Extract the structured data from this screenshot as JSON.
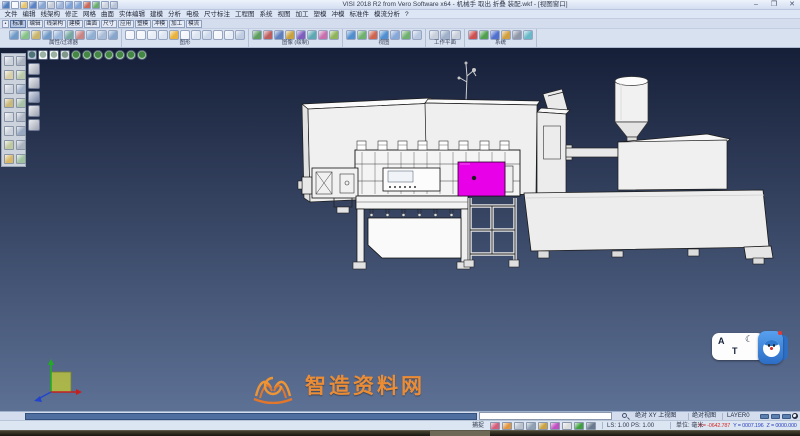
{
  "colors": {
    "vp_top": "#161f38",
    "vp_bottom": "#5d7195",
    "accent_magenta": "#e800e8",
    "watermark_orange": "#ec8d35",
    "statusbar_blue": "#4f6fa0",
    "coord_x_red": "#d42a2a",
    "coord_yz_blue": "#2a3fbf"
  },
  "window": {
    "title": "VISI 2018 R2 from Vero Software x64 - 机械手 取出 折叠 装配.wkf - [视图窗口]",
    "minimize": "–",
    "maximize": "❐",
    "close": "✕"
  },
  "quick_access": {
    "icons": [
      {
        "name": "app-icon",
        "color": "#4f7ec0"
      },
      {
        "name": "new-file-icon",
        "color": "#f4f7fb"
      },
      {
        "name": "open-file-icon",
        "color": "#e9c66a"
      },
      {
        "name": "save-icon",
        "color": "#5a82c4"
      },
      {
        "name": "save-all-icon",
        "color": "#86a6d6"
      },
      {
        "name": "print-icon",
        "color": "#c6cdd8"
      },
      {
        "name": "plot-icon",
        "color": "#9fb6da"
      },
      {
        "name": "undo-icon",
        "color": "#7fa3d8"
      },
      {
        "name": "redo-icon",
        "color": "#7fa3d8"
      },
      {
        "name": "delete-icon",
        "color": "#c96a5a"
      },
      {
        "name": "refresh-icon",
        "color": "#6aae6a"
      },
      {
        "name": "settings-icon",
        "color": "#ccd3de"
      },
      {
        "name": "help-icon",
        "color": "#b9c4d6"
      }
    ]
  },
  "menubar": {
    "items": [
      "文件",
      "编辑",
      "线架构",
      "修正",
      "网格",
      "曲面",
      "实体编辑",
      "建模",
      "分析",
      "电极",
      "尺寸标注",
      "工程图",
      "系统",
      "视图",
      "加工",
      "塑模",
      "冲模",
      "标准件",
      "模流分析",
      "?"
    ]
  },
  "tabbar": {
    "prefix": "•",
    "tabs": [
      "标准",
      "编辑",
      "线架构",
      "建模",
      "曲面",
      "尺寸",
      "应用",
      "塑模",
      "冲模",
      "加工",
      "模流"
    ]
  },
  "toolbar": {
    "groups": [
      {
        "label": "属性/过滤器",
        "icons": [
          {
            "name": "attr-color-icon",
            "color": "#6f9ac8"
          },
          {
            "name": "attr-layer-icon",
            "color": "#85c285"
          },
          {
            "name": "attr-linetype-icon",
            "color": "#c8b46a"
          },
          {
            "name": "filter-point-icon",
            "color": "#6f9ac8"
          },
          {
            "name": "filter-line-icon",
            "color": "#9ab6da"
          },
          {
            "name": "filter-surface-icon",
            "color": "#74a8a0"
          },
          {
            "name": "filter-solid-icon",
            "color": "#c88585"
          },
          {
            "name": "filter-all-icon",
            "color": "#8fb0d5"
          },
          {
            "name": "selection-mask-icon",
            "color": "#a8bcd8"
          },
          {
            "name": "quick-filter-icon",
            "color": "#87a6cc"
          }
        ]
      },
      {
        "label": "图形",
        "icons": [
          {
            "name": "new-drawing-icon",
            "color": "#f3f6fb"
          },
          {
            "name": "open-drawing-icon",
            "color": "#f3f6fb"
          },
          {
            "name": "insert-drawing-icon",
            "color": "#e7edf6"
          },
          {
            "name": "page-setup-icon",
            "color": "#dbe4f1"
          },
          {
            "name": "highlight-entities-icon",
            "color": "#e8b23c"
          },
          {
            "name": "hide-entities-icon",
            "color": "#f3f6fb"
          },
          {
            "name": "show-all-icon",
            "color": "#dbe4f1"
          },
          {
            "name": "blank-icon",
            "color": "#cdd9ea"
          },
          {
            "name": "unblank-icon",
            "color": "#f3f6fb"
          },
          {
            "name": "group-icon",
            "color": "#e7edf6"
          },
          {
            "name": "ungroup-icon",
            "color": "#bfcce2"
          }
        ]
      },
      {
        "label": "图像 (绘制)",
        "icons": [
          {
            "name": "shade-icon",
            "color": "#5d9e5d"
          },
          {
            "name": "render-icon",
            "color": "#bf5d5d"
          },
          {
            "name": "texture-icon",
            "color": "#5d7ebf"
          },
          {
            "name": "material-icon",
            "color": "#c9a23f"
          },
          {
            "name": "light-icon",
            "color": "#7e5dbf"
          },
          {
            "name": "snapshot-icon",
            "color": "#5da8b2"
          },
          {
            "name": "background-icon",
            "color": "#c96fae"
          },
          {
            "name": "draw-mode-icon",
            "color": "#8fb45a"
          }
        ]
      },
      {
        "label": "视图",
        "icons": [
          {
            "name": "zoom-fit-icon",
            "color": "#4f8fd0"
          },
          {
            "name": "zoom-window-icon",
            "color": "#6fb06f"
          },
          {
            "name": "pan-icon",
            "color": "#d0644f"
          },
          {
            "name": "rotate-view-icon",
            "color": "#4f8fd0"
          },
          {
            "name": "previous-view-icon",
            "color": "#86a8d8"
          },
          {
            "name": "named-view-icon",
            "color": "#6fb06f"
          },
          {
            "name": "redraw-icon",
            "color": "#b8c8e0"
          }
        ]
      },
      {
        "label": "工作平面",
        "icons": [
          {
            "name": "workplane-xy-icon",
            "color": "#c8cfda"
          },
          {
            "name": "workplane-entity-icon",
            "color": "#9fb0c8"
          },
          {
            "name": "workplane-view-icon",
            "color": "#c8cfda"
          }
        ]
      },
      {
        "label": "系统",
        "icons": [
          {
            "name": "layer-manager-icon",
            "color": "#d05050"
          },
          {
            "name": "color-table-icon",
            "color": "#50a050"
          },
          {
            "name": "globe-icon",
            "color": "#5070d0"
          },
          {
            "name": "calculator-icon",
            "color": "#d0a040"
          },
          {
            "name": "options-icon",
            "color": "#9098a8"
          },
          {
            "name": "macro-icon",
            "color": "#68b8c8"
          }
        ]
      }
    ]
  },
  "view_toolbar": {
    "icons": [
      {
        "name": "tile-windows-icon",
        "color": "#7a92b8",
        "radius": "2px"
      },
      {
        "name": "shaded-view-icon",
        "color": "#eef2f8",
        "radius": "2px"
      },
      {
        "name": "wireframe-view-icon",
        "color": "#eef2f8",
        "radius": "2px"
      },
      {
        "name": "hidden-line-view-icon",
        "color": "#c2c8d2",
        "radius": "2px"
      },
      {
        "name": "iso-view-icon",
        "color": "#69ad69",
        "radius": "50%"
      },
      {
        "name": "top-view-icon",
        "color": "#69ad69",
        "radius": "50%"
      },
      {
        "name": "front-view-icon",
        "color": "#69ad69",
        "radius": "50%"
      },
      {
        "name": "right-view-icon",
        "color": "#69ad69",
        "radius": "50%"
      },
      {
        "name": "left-view-icon",
        "color": "#69ad69",
        "radius": "50%"
      },
      {
        "name": "back-view-icon",
        "color": "#69ad69",
        "radius": "50%"
      },
      {
        "name": "bottom-view-icon",
        "color": "#69ad69",
        "radius": "50%"
      }
    ]
  },
  "left_toolbar_a": {
    "icons": [
      {
        "name": "pointer-icon",
        "color": "#cdd3dc"
      },
      {
        "name": "window-select-icon",
        "color": "#aab2c0"
      },
      {
        "name": "chain-select-icon",
        "color": "#d8cfa8"
      },
      {
        "name": "snap-end-icon",
        "color": "#b8c8a8"
      },
      {
        "name": "snap-mid-icon",
        "color": "#cdd3dc"
      },
      {
        "name": "snap-center-icon",
        "color": "#9fb0c8"
      },
      {
        "name": "snap-intersection-icon",
        "color": "#c8b87a"
      },
      {
        "name": "snap-point-icon",
        "color": "#a8c0a8"
      },
      {
        "name": "measure-icon",
        "color": "#d0d5de"
      },
      {
        "name": "dimension-icon",
        "color": "#b0b8c6"
      },
      {
        "name": "trim-icon",
        "color": "#cdd3dc"
      },
      {
        "name": "extend-icon",
        "color": "#98a8c0"
      },
      {
        "name": "move-icon",
        "color": "#c0c8a0"
      },
      {
        "name": "rotate-icon",
        "color": "#aab2c0"
      },
      {
        "name": "mirror-icon",
        "color": "#d8b868"
      },
      {
        "name": "scale-icon",
        "color": "#9fc09f"
      }
    ]
  },
  "left_toolbar_b": {
    "icons": [
      {
        "name": "view-manager-icon",
        "color": "#b9bfca"
      },
      {
        "name": "section-icon",
        "color": "#b9bfca"
      },
      {
        "name": "clip-plane-icon",
        "color": "#8898b8"
      },
      {
        "name": "camera-icon",
        "color": "#b9bfca"
      },
      {
        "name": "display-mode-icon",
        "color": "#b9bfca"
      }
    ]
  },
  "viewport": {
    "watermark_text": "智造资料网",
    "ime": {
      "letter_a": "A",
      "letter_moon": "☾",
      "letter_t": "T"
    }
  },
  "statusbar1": {
    "view_label": "绝对 XY 上视图",
    "coord_label": "绝对视图",
    "layer_label": "LAYER0",
    "buttons": [
      {
        "name": "layer-toggle-1-button",
        "color": "#5b7fae"
      },
      {
        "name": "layer-toggle-2-button",
        "color": "#5b7fae"
      },
      {
        "name": "layer-toggle-3-button",
        "color": "#5b7fae"
      }
    ]
  },
  "statusbar2": {
    "snap_label": "捕捉",
    "icons": [
      {
        "name": "entity-info-icon",
        "color": "#d65c7a"
      },
      {
        "name": "profile-icon",
        "color": "#e0953f"
      },
      {
        "name": "layers-icon",
        "color": "#b9c1cc"
      },
      {
        "name": "attributes-icon",
        "color": "#8fa0b2"
      },
      {
        "name": "wcs-icon",
        "color": "#caa23f"
      },
      {
        "name": "snap-magnet-icon",
        "color": "#c24fc2"
      },
      {
        "name": "ortho-icon",
        "color": "#dcdcdc"
      },
      {
        "name": "timer-icon",
        "color": "#3fa03f"
      },
      {
        "name": "grid-icon",
        "color": "#6a7a8e"
      }
    ],
    "scale_label": "LS: 1.00 PS: 1.00",
    "units_label": "单位: 毫米",
    "coord_x": "X = -0642.787",
    "coord_y": "Y = 0007.196",
    "coord_z": "Z = 0000.000"
  }
}
